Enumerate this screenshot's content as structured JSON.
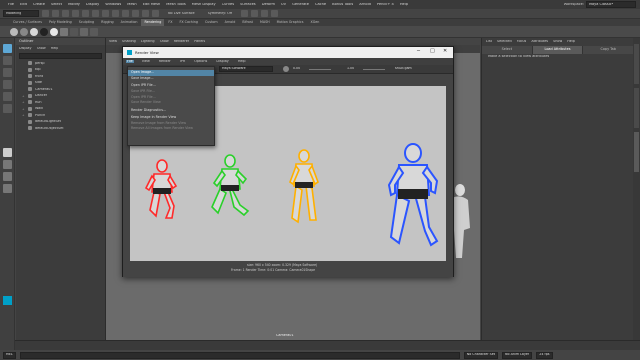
{
  "main_menu": [
    "File",
    "Edit",
    "Create",
    "Select",
    "Modify",
    "Display",
    "Windows",
    "Mesh",
    "Edit Mesh",
    "Mesh Tools",
    "Mesh Display",
    "Curves",
    "Surfaces",
    "Deform",
    "UV",
    "Generate",
    "Cache",
    "Bonus Tools",
    "Arnold",
    "Pencil+ 4",
    "Help"
  ],
  "workspace": {
    "label": "Workspace:",
    "value": "Maya Classic*"
  },
  "status_line": {
    "mode": "Modeling",
    "live_surface": "No Live Surface",
    "symmetry": "Symmetry: Off"
  },
  "shelf_tabs": [
    "Curves / Surfaces",
    "Poly Modeling",
    "Sculpting",
    "Rigging",
    "Animation",
    "Rendering",
    "FX",
    "FX Caching",
    "Custom",
    "Arnold",
    "Bifrost",
    "MASH",
    "Motion Graphics",
    "XGen"
  ],
  "shelf_active_tab": "Rendering",
  "outliner": {
    "title": "Outliner",
    "menu": [
      "Display",
      "Show",
      "Help"
    ],
    "items": [
      "persp",
      "top",
      "front",
      "side",
      "Camera01",
      "Dancer",
      "Run",
      "Walk",
      "Punch",
      "defaultLightSet",
      "defaultObjectSet"
    ]
  },
  "viewport": {
    "menu": [
      "View",
      "Shading",
      "Lighting",
      "Show",
      "Renderer",
      "Panels"
    ],
    "camera_label": "Camera01"
  },
  "attribute_editor": {
    "menu": [
      "List",
      "Selected",
      "Focus",
      "Attributes",
      "Show",
      "Help"
    ],
    "message": "Make a selection to view attributes",
    "buttons": [
      "Select",
      "Load Attributes",
      "Copy Tab"
    ]
  },
  "render_view": {
    "title": "Render View",
    "menu": [
      "File",
      "View",
      "Render",
      "IPR",
      "Options",
      "Display",
      "Help"
    ],
    "active_menu": "File",
    "renderer": "Maya Software",
    "exposure": "0.00",
    "gamma": "1.00",
    "color_space": "sRGB gam",
    "status_line1": "size: 960 x 540  zoom: 0.329     (Maya Software)",
    "status_line2": "Frame: 1        Render Time: 0:01        Camera: Camera01Shape",
    "file_menu": [
      {
        "label": "Open Image...",
        "state": "highlighted"
      },
      {
        "label": "Save Image...",
        "state": "enabled"
      },
      {
        "label": "",
        "state": "separator"
      },
      {
        "label": "Open IPR File...",
        "state": "enabled"
      },
      {
        "label": "Save IPR File...",
        "state": "disabled"
      },
      {
        "label": "Open IPR File...",
        "state": "disabled"
      },
      {
        "label": "Save Render View",
        "state": "disabled"
      },
      {
        "label": "",
        "state": "separator"
      },
      {
        "label": "Render Diagnostics...",
        "state": "enabled"
      },
      {
        "label": "",
        "state": "separator"
      },
      {
        "label": "Keep Image in Render View",
        "state": "enabled"
      },
      {
        "label": "Remove Image from Render View",
        "state": "disabled"
      },
      {
        "label": "Remove All Images from Render View",
        "state": "disabled"
      }
    ]
  },
  "command_line": {
    "language": "MEL",
    "character_set": "No Character Set",
    "anim_layer": "No Anim Layer",
    "fps": "24 fps"
  },
  "colors": {
    "accent_blue": "#5285a6",
    "figure_red": "#ff2a2a",
    "figure_green": "#2ad02a",
    "figure_orange": "#ffb000",
    "figure_blue": "#2b55ff"
  }
}
